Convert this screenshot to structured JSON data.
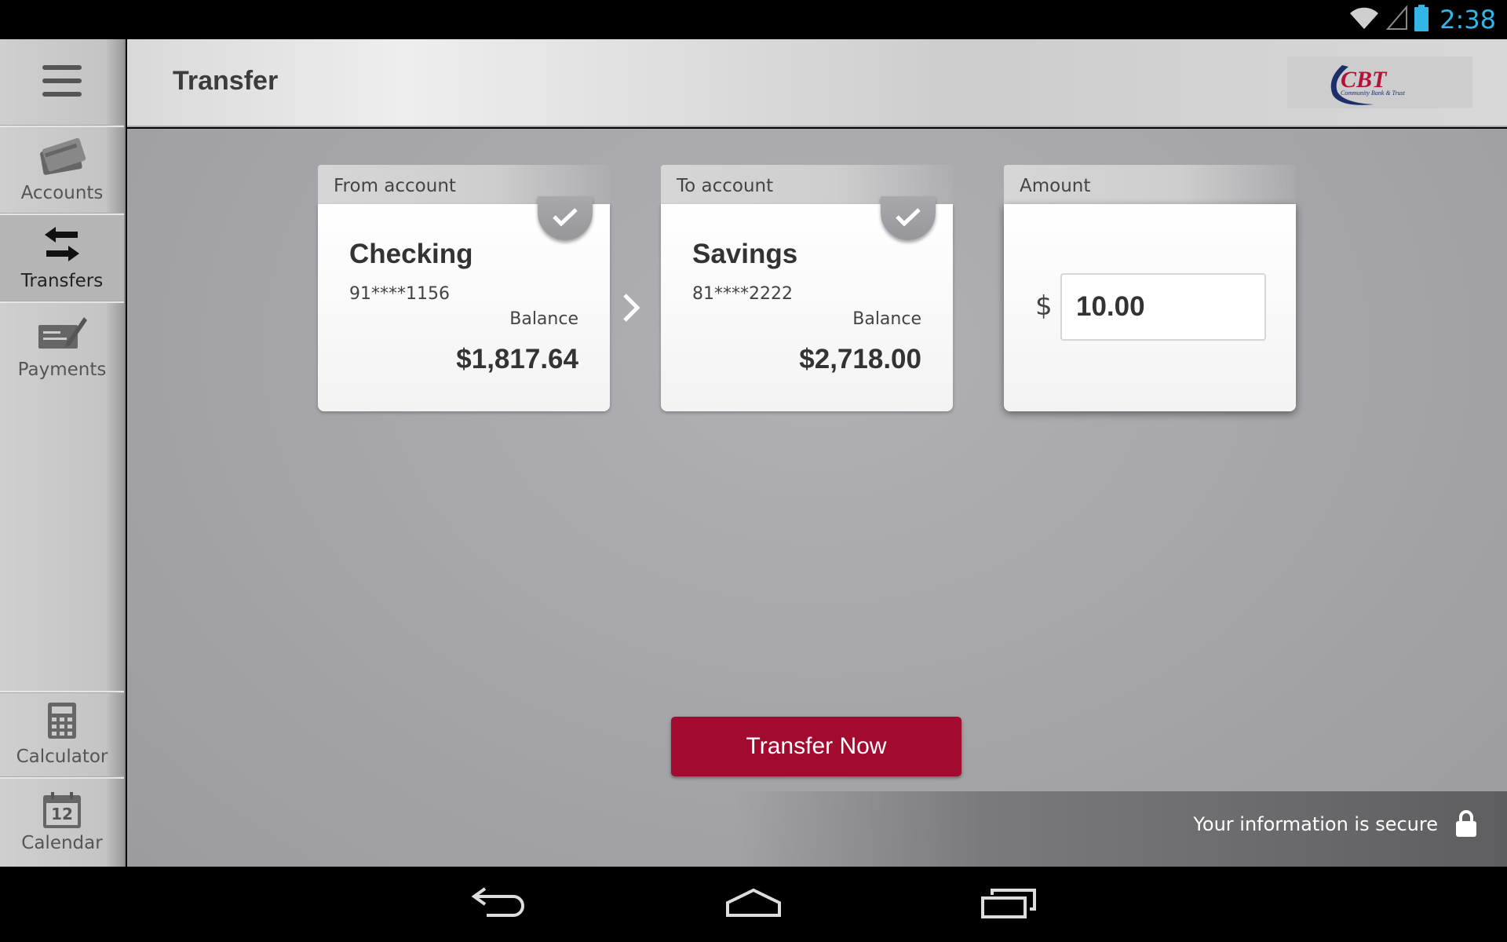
{
  "status": {
    "time": "2:38"
  },
  "sidebar": {
    "items": [
      {
        "label": "Accounts"
      },
      {
        "label": "Transfers"
      },
      {
        "label": "Payments"
      },
      {
        "label": "Calculator"
      },
      {
        "label": "Calendar",
        "calendar_day": "12"
      }
    ]
  },
  "header": {
    "title": "Transfer",
    "logo_text": "CBT",
    "logo_subtext": "Community Bank & Trust"
  },
  "from_account": {
    "tab_label": "From account",
    "name": "Checking",
    "number": "91****1156",
    "balance_label": "Balance",
    "balance": "$1,817.64"
  },
  "to_account": {
    "tab_label": "To account",
    "name": "Savings",
    "number": "81****2222",
    "balance_label": "Balance",
    "balance": "$2,718.00"
  },
  "amount": {
    "tab_label": "Amount",
    "currency_symbol": "$",
    "value": "10.00"
  },
  "actions": {
    "transfer_now_label": "Transfer Now"
  },
  "footer": {
    "secure_text": "Your information is secure"
  },
  "colors": {
    "accent": "#a20a30",
    "status_time": "#33b5e5",
    "logo_red": "#b5123a",
    "logo_navy": "#1d2f6b"
  }
}
